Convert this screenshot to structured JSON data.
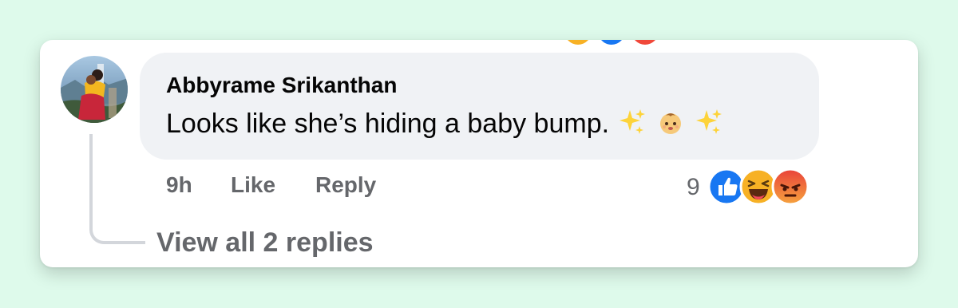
{
  "comment": {
    "author": "Abbyrame Srikanthan",
    "text": "Looks like she’s hiding a baby bump.",
    "emojis": [
      "sparkles",
      "baby",
      "sparkles"
    ],
    "time": "9h",
    "like_label": "Like",
    "reply_label": "Reply",
    "reaction_count": "9",
    "reactions": [
      "like",
      "haha",
      "angry"
    ]
  },
  "replies": {
    "label": "View all 2 replies"
  },
  "colors": {
    "page_bg": "#defaeb",
    "bubble_bg": "#f0f2f5",
    "muted_text": "#65676b",
    "like_blue": "#1877f2"
  }
}
